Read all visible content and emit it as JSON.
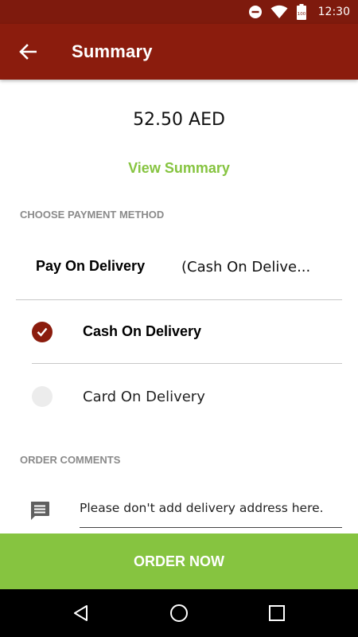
{
  "status_bar": {
    "time": "12:30",
    "battery_level": "100",
    "icons": [
      "do-not-disturb-icon",
      "wifi-icon",
      "battery-icon"
    ]
  },
  "app_bar": {
    "title": "Summary",
    "back_icon": "arrow-left-icon"
  },
  "summary": {
    "amount": "52.50 AED",
    "view_summary_label": "View Summary"
  },
  "payment": {
    "section_title": "CHOOSE PAYMENT METHOD",
    "label": "Pay On Delivery",
    "selected_value": "(Cash On Delive...",
    "options": [
      {
        "label": "Cash On Delivery",
        "selected": true
      },
      {
        "label": "Card On Delivery",
        "selected": false
      }
    ]
  },
  "comments": {
    "section_title": "ORDER COMMENTS",
    "placeholder": "Please don't add delivery address here.",
    "icon": "comment-icon"
  },
  "order_button": {
    "label": "ORDER NOW"
  },
  "nav_bar": {
    "icons": [
      "back-triangle-icon",
      "home-circle-icon",
      "recents-square-icon"
    ]
  },
  "colors": {
    "primary": "#8b1c0d",
    "status_bar": "#7e1a0d",
    "accent_green": "#86c440",
    "section_header_gray": "#8a8a8a"
  }
}
